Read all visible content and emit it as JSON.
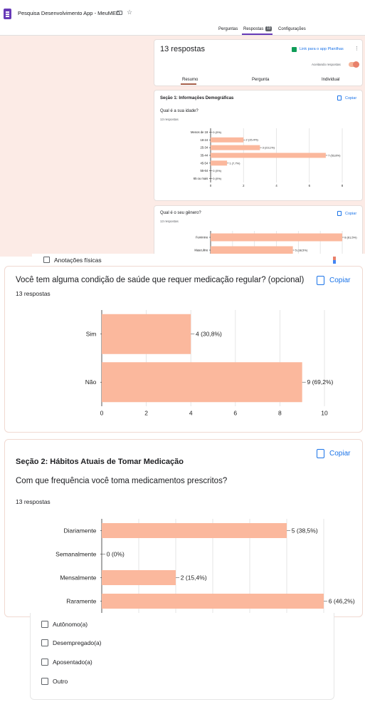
{
  "header": {
    "title": "Pesquisa Desenvolvimento App - MeuMED",
    "tabs": [
      {
        "label": "Perguntas"
      },
      {
        "label": "Respostas",
        "badge": "13"
      },
      {
        "label": "Configurações"
      }
    ]
  },
  "summary": {
    "title": "13 respostas",
    "sheets_link": "Link para o app Planilhas",
    "accepting_label": "Aceitando respostas",
    "accepting": true,
    "subtabs": [
      "Resumo",
      "Pergunta",
      "Individual"
    ]
  },
  "copy_label": "Copiar",
  "section1": {
    "title": "Seção 1: Informações Demográficas",
    "age_question": "Qual é a sua idade?",
    "age_count": "13 respostas",
    "gender_question": "Qual é o seu gênero?",
    "gender_count": "13 respostas"
  },
  "overlay": {
    "notes_label": "Anotações físicas"
  },
  "health": {
    "question": "Você tem alguma condição de saúde que requer medicação regular? (opcional)",
    "count": "13 respostas"
  },
  "section2": {
    "title": "Seção 2: Hábitos Atuais de Tomar Medicação",
    "question": "Com que frequência você toma medicamentos prescritos?",
    "count": "13 respostas"
  },
  "employment_options": [
    "Autônomo(a)",
    "Desempregado(a)",
    "Aposentado(a)",
    "Outro"
  ],
  "colors": {
    "bar": "#fbb89d",
    "accent": "#1a73e8",
    "form": "#673ab7",
    "pink_bg": "#fcebe6"
  },
  "chart_data": [
    {
      "type": "bar",
      "orientation": "horizontal",
      "title": "Qual é a sua idade?",
      "categories": [
        "Menos de 18",
        "18-24",
        "25-34",
        "35-44",
        "45-54",
        "55-64",
        "65 ou mais"
      ],
      "values": [
        0,
        2,
        3,
        7,
        1,
        0,
        0
      ],
      "labels": [
        "0 (0%)",
        "2 (15,4%)",
        "3 (23,1%)",
        "7 (53,8%)",
        "1 (7,7%)",
        "0 (0%)",
        "0 (0%)"
      ],
      "xticks": [
        "0",
        "2",
        "4",
        "6",
        "8"
      ],
      "xlim": [
        0,
        8
      ]
    },
    {
      "type": "bar",
      "orientation": "horizontal",
      "title": "Qual é o seu gênero?",
      "categories": [
        "Feminino",
        "Masculino"
      ],
      "values": [
        8,
        5
      ],
      "labels": [
        "8 (61,5%)",
        "5 (38,5%)"
      ],
      "xlim": [
        0,
        8
      ]
    },
    {
      "type": "bar",
      "orientation": "horizontal",
      "title": "Você tem alguma condição de saúde que requer medicação regular? (opcional)",
      "categories": [
        "Sim",
        "Não"
      ],
      "values": [
        4,
        9
      ],
      "labels": [
        "4 (30,8%)",
        "9 (69,2%)"
      ],
      "xticks": [
        "0",
        "2",
        "4",
        "6",
        "8",
        "10"
      ],
      "xlim": [
        0,
        10
      ]
    },
    {
      "type": "bar",
      "orientation": "horizontal",
      "title": "Com que frequência você toma medicamentos prescritos?",
      "categories": [
        "Diariamente",
        "Semanalmente",
        "Mensalmente",
        "Raramente"
      ],
      "values": [
        5,
        0,
        2,
        6
      ],
      "labels": [
        "5 (38,5%)",
        "0 (0%)",
        "2 (15,4%)",
        "6 (46,2%)"
      ],
      "xlim": [
        0,
        6
      ]
    }
  ]
}
